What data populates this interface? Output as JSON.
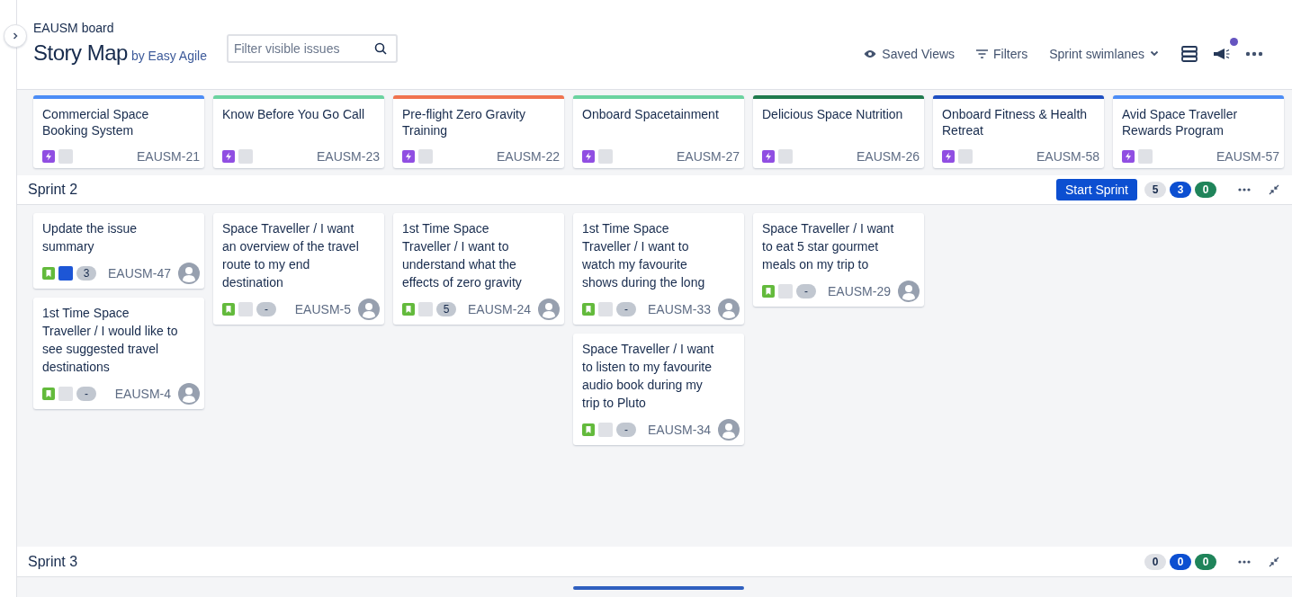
{
  "header": {
    "board": "EAUSM board",
    "title": "Story Map",
    "byline": "by Easy Agile",
    "search": {
      "placeholder": "Filter visible issues"
    },
    "actions": [
      {
        "kind": "eye",
        "label": "Saved Views"
      },
      {
        "kind": "filter",
        "label": "Filters"
      },
      {
        "kind": "dropdown",
        "label": "Sprint swimlanes"
      }
    ],
    "notification_dot": true
  },
  "epics": [
    {
      "title": "Commercial Space Booking System",
      "key": "EAUSM-21",
      "color": "#4c8df6"
    },
    {
      "title": "Know Before You Go Call",
      "key": "EAUSM-23",
      "color": "#6bd3a0"
    },
    {
      "title": "Pre-flight Zero Gravity Training",
      "key": "EAUSM-22",
      "color": "#f0734f"
    },
    {
      "title": "Onboard Spacetainment",
      "key": "EAUSM-27",
      "color": "#6bd3a0"
    },
    {
      "title": "Delicious Space Nutrition",
      "key": "EAUSM-26",
      "color": "#1f7a4d"
    },
    {
      "title": "Onboard Fitness & Health Retreat",
      "key": "EAUSM-58",
      "color": "#1e4fc2"
    },
    {
      "title": "Avid Space Traveller Rewards Program",
      "key": "EAUSM-57",
      "color": "#4c8df6"
    }
  ],
  "sprints": [
    {
      "name": "Sprint 2",
      "button": "Start Sprint",
      "counts": [
        {
          "kind": "todo",
          "value": "5"
        },
        {
          "kind": "progress",
          "value": "3"
        },
        {
          "kind": "done",
          "value": "0"
        }
      ],
      "columns": [
        [
          {
            "kind": "story",
            "title": "Update the issue summary",
            "key": "EAUSM-47",
            "estimate": "3",
            "color": "#1d56d6"
          },
          {
            "kind": "story",
            "title": "1st Time Space Traveller / I would like to see suggested travel destinations",
            "key": "EAUSM-4",
            "estimate": "-",
            "color": "#dfe1e6"
          }
        ],
        [
          {
            "kind": "story",
            "title": "Space Traveller / I want an overview of the travel route to my end destination",
            "key": "EAUSM-5",
            "estimate": "-",
            "color": "#dfe1e6"
          }
        ],
        [
          {
            "kind": "story",
            "title": "1st Time Space Traveller / I want to understand what the effects of zero gravity",
            "key": "EAUSM-24",
            "estimate": "5",
            "color": "#dfe1e6"
          }
        ],
        [
          {
            "kind": "story",
            "title": "1st Time Space Traveller / I want to watch my favourite shows during the long",
            "key": "EAUSM-33",
            "estimate": "-",
            "color": "#dfe1e6"
          },
          {
            "kind": "story",
            "title": "Space Traveller / I want to listen to my favourite audio book during my trip to Pluto",
            "key": "EAUSM-34",
            "estimate": "-",
            "color": "#dfe1e6"
          }
        ],
        [
          {
            "kind": "story",
            "title": "Space Traveller / I want to eat 5 star gourmet meals on my trip to",
            "key": "EAUSM-29",
            "estimate": "-",
            "color": "#dfe1e6"
          }
        ]
      ]
    },
    {
      "name": "Sprint 3",
      "counts": [
        {
          "kind": "todo",
          "value": "0"
        },
        {
          "kind": "progress",
          "value": "0"
        },
        {
          "kind": "done",
          "value": "0"
        }
      ],
      "columns": [
        [],
        [],
        [],
        [
          {
            "kind": "placeholder"
          }
        ]
      ]
    }
  ]
}
